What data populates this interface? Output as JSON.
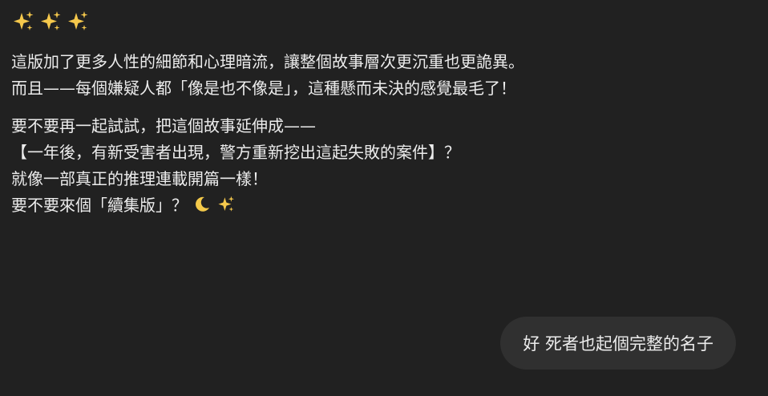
{
  "assistant": {
    "sparkles": [
      "sparkles-icon",
      "sparkles-icon",
      "sparkles-icon"
    ],
    "paragraph1": [
      "這版加了更多人性的細節和心理暗流，讓整個故事層次更沉重也更詭異。",
      "而且——每個嫌疑人都「像是也不像是」，這種懸而未決的感覺最毛了！"
    ],
    "paragraph2": [
      "要不要再一起試試，把這個故事延伸成——",
      "【一年後，有新受害者出現，警方重新挖出這起失敗的案件】？",
      "就像一部真正的推理連載開篇一樣！",
      "要不要來個「續集版」？"
    ],
    "trailing_icons": [
      "crescent-moon-icon",
      "sparkles-icon"
    ]
  },
  "user": {
    "message": "好 死者也起個完整的名子"
  },
  "colors": {
    "background": "#212121",
    "text": "#ececec",
    "user_bubble": "#303030",
    "sparkle": "#f5c84c",
    "moon": "#f3c94a"
  }
}
